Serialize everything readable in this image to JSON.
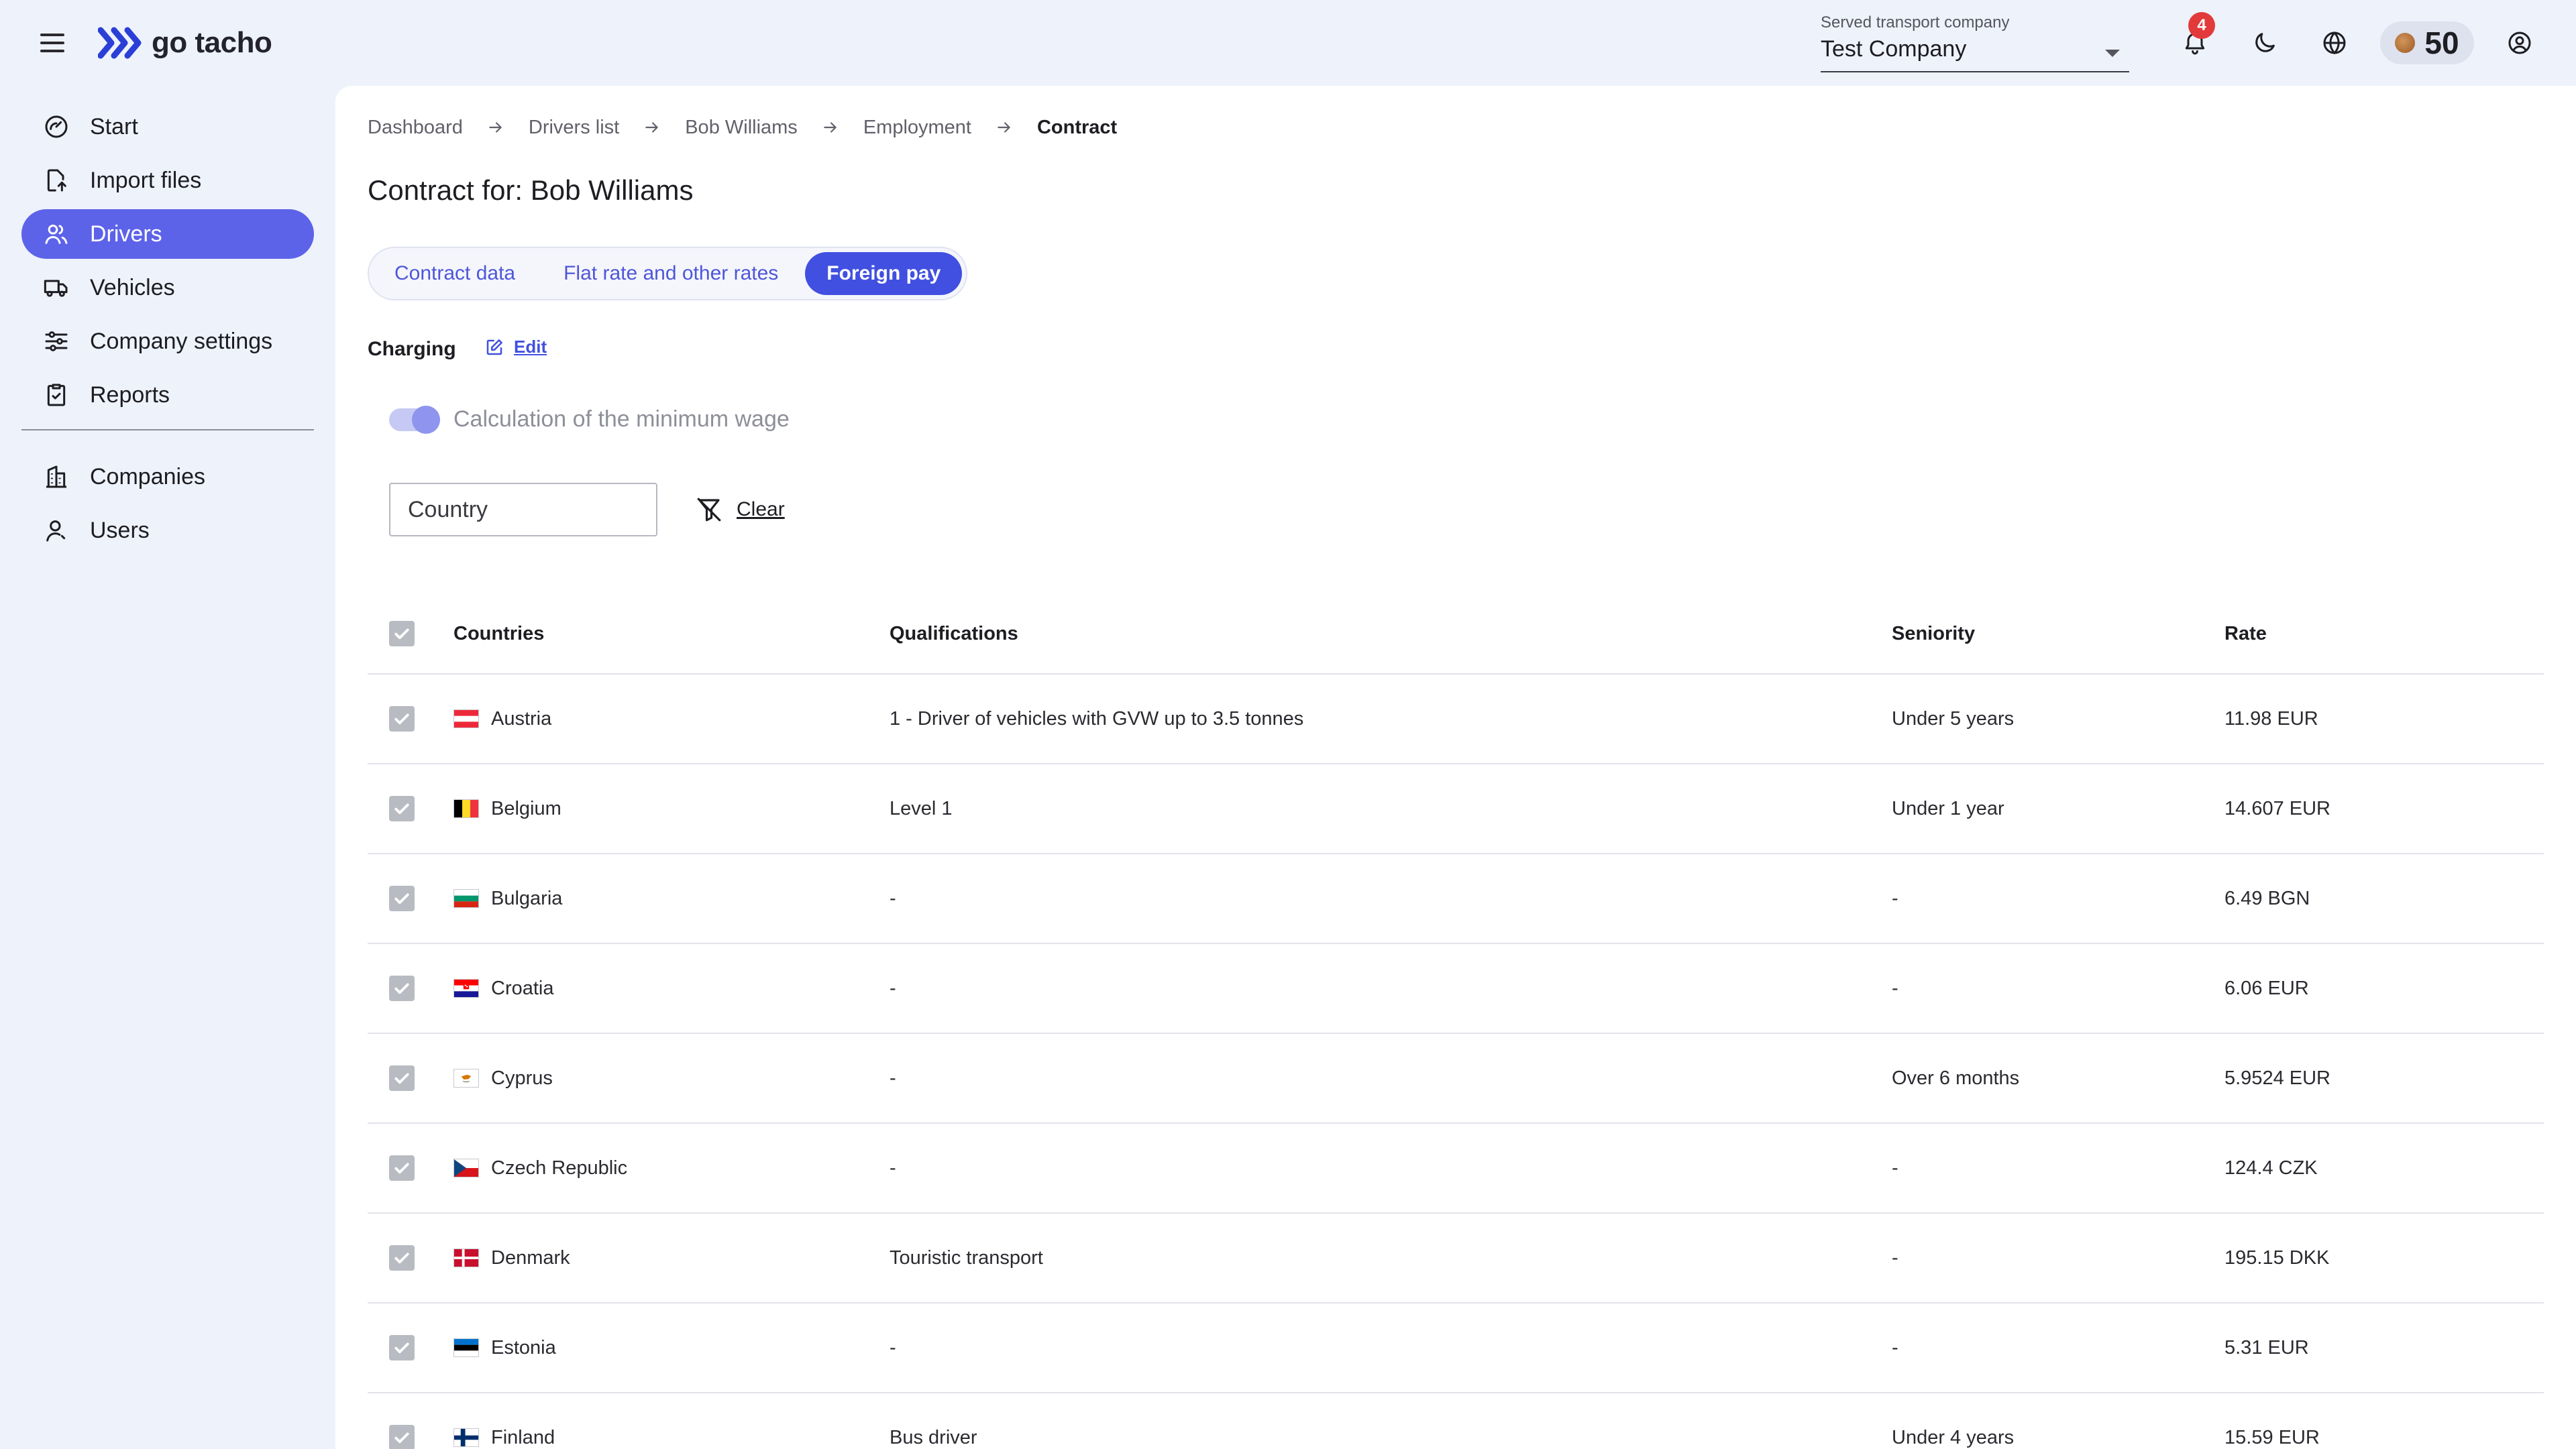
{
  "app": {
    "brand": "go tacho"
  },
  "header": {
    "company_label": "Served transport company",
    "company_value": "Test Company",
    "notification_count": "4",
    "coins": "50"
  },
  "sidebar": {
    "items": [
      {
        "label": "Start",
        "icon": "gauge-icon"
      },
      {
        "label": "Import files",
        "icon": "file-import-icon"
      },
      {
        "label": "Drivers",
        "icon": "users-icon"
      },
      {
        "label": "Vehicles",
        "icon": "truck-icon"
      },
      {
        "label": "Company settings",
        "icon": "sliders-icon"
      },
      {
        "label": "Reports",
        "icon": "clipboard-icon"
      }
    ],
    "secondary_items": [
      {
        "label": "Companies",
        "icon": "building-icon"
      },
      {
        "label": "Users",
        "icon": "user-icon"
      }
    ],
    "active_item": "Drivers"
  },
  "breadcrumb": [
    "Dashboard",
    "Drivers list",
    "Bob Williams",
    "Employment",
    "Contract"
  ],
  "page": {
    "title_prefix": "Contract for: ",
    "title_name": "Bob Williams"
  },
  "tabs": [
    "Contract data",
    "Flat rate and other rates",
    "Foreign pay"
  ],
  "active_tab": "Foreign pay",
  "charging": {
    "label": "Charging",
    "edit_label": "Edit",
    "toggle_label": "Calculation of the minimum wage",
    "toggle_on": true
  },
  "filter": {
    "placeholder": "Country",
    "clear_label": "Clear"
  },
  "table": {
    "headers": [
      "Countries",
      "Qualifications",
      "Seniority",
      "Rate"
    ],
    "rows": [
      {
        "country": "Austria",
        "flag": "austria",
        "qualification": "1 - Driver of vehicles with GVW up to 3.5 tonnes",
        "seniority": "Under 5 years",
        "rate": "11.98 EUR",
        "checked": true
      },
      {
        "country": "Belgium",
        "flag": "belgium",
        "qualification": "Level 1",
        "seniority": "Under 1 year",
        "rate": "14.607 EUR",
        "checked": true
      },
      {
        "country": "Bulgaria",
        "flag": "bulgaria",
        "qualification": "-",
        "seniority": "-",
        "rate": "6.49 BGN",
        "checked": true
      },
      {
        "country": "Croatia",
        "flag": "croatia",
        "qualification": "-",
        "seniority": "-",
        "rate": "6.06 EUR",
        "checked": true
      },
      {
        "country": "Cyprus",
        "flag": "cyprus",
        "qualification": "-",
        "seniority": "Over 6 months",
        "rate": "5.9524 EUR",
        "checked": true
      },
      {
        "country": "Czech Republic",
        "flag": "czech",
        "qualification": "-",
        "seniority": "-",
        "rate": "124.4 CZK",
        "checked": true
      },
      {
        "country": "Denmark",
        "flag": "denmark",
        "qualification": "Touristic transport",
        "seniority": "-",
        "rate": "195.15 DKK",
        "checked": true
      },
      {
        "country": "Estonia",
        "flag": "estonia",
        "qualification": "-",
        "seniority": "-",
        "rate": "5.31 EUR",
        "checked": true
      },
      {
        "country": "Finland",
        "flag": "finland",
        "qualification": "Bus driver",
        "seniority": "Under 4 years",
        "rate": "15.59 EUR",
        "checked": true
      }
    ]
  },
  "colors": {
    "accent": "#4150e0",
    "active_nav": "#5d63e8",
    "background": "#eef2fb",
    "badge": "#e23a3a"
  }
}
